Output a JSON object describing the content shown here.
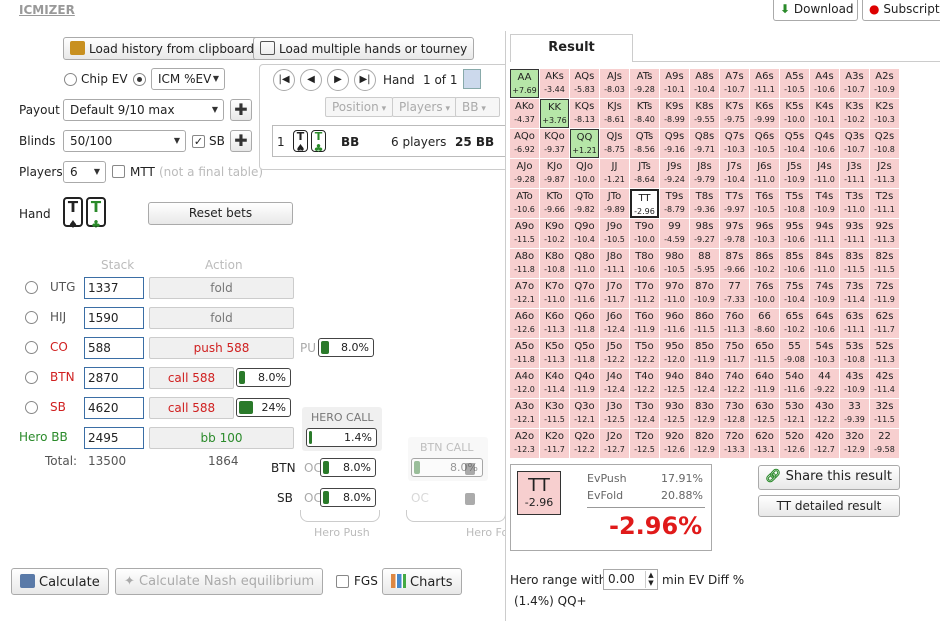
{
  "logo": "ICMIZER",
  "top": {
    "download": "Download",
    "subscription": "Subscriptio"
  },
  "load_clip": "Load history from clipboard",
  "load_multi": "Load multiple hands or tourney",
  "mode": {
    "chip_ev": "Chip EV",
    "icm": "ICM %EV"
  },
  "payout": {
    "label": "Payout",
    "value": "Default 9/10 max"
  },
  "blinds": {
    "label": "Blinds",
    "value": "50/100",
    "sb": "SB"
  },
  "players": {
    "label": "Players",
    "value": "6",
    "mtt": "MTT",
    "note": "(not a final table)"
  },
  "hand_label": "Hand",
  "reset": "Reset bets",
  "col_stack": "Stack",
  "col_action": "Action",
  "seats": [
    {
      "pos": "UTG",
      "stack": "1337",
      "action": "fold"
    },
    {
      "pos": "HIJ",
      "stack": "1590",
      "action": "fold"
    },
    {
      "pos": "CO",
      "stack": "588",
      "action": "push 588"
    },
    {
      "pos": "BTN",
      "stack": "2870",
      "action": "call 588"
    },
    {
      "pos": "SB",
      "stack": "4620",
      "action": "call 588"
    },
    {
      "pos": "Hero BB",
      "stack": "2495",
      "action": "bb 100"
    }
  ],
  "totals": {
    "label": "Total:",
    "stack": "13500",
    "action": "1864"
  },
  "pu": {
    "label": "PU",
    "value": "8.0%",
    "fill": 0.08
  },
  "btn_call_pct": {
    "value": "8.0%",
    "fill": 0.08
  },
  "sb_call_pct": {
    "value": "24%",
    "fill": 0.24
  },
  "hero_call": {
    "title": "HERO CALL",
    "value": "1.4%",
    "fill": 0.014
  },
  "btn_call": {
    "title": "BTN CALL",
    "value": "8.0%",
    "fill": 0.08
  },
  "side": {
    "btn": "BTN",
    "sb": "SB",
    "oc": "OC",
    "btn_value": "8.0%",
    "sb_value": "8.0%"
  },
  "hero_push": "Hero Push",
  "hero_fold": "Hero Fo",
  "hand_nav": {
    "label": "Hand",
    "count": "1 of 1"
  },
  "filters": [
    "Position",
    "Players",
    "BB"
  ],
  "hand_row": {
    "num": "1",
    "pos": "BB",
    "players": "6 players",
    "bb": "25 BB"
  },
  "result_tab": "Result",
  "grid": [
    [
      [
        "AA",
        "+7.69"
      ],
      [
        "AKs",
        "-3.44"
      ],
      [
        "AQs",
        "-5.83"
      ],
      [
        "AJs",
        "-8.03"
      ],
      [
        "ATs",
        "-9.28"
      ],
      [
        "A9s",
        "-10.1"
      ],
      [
        "A8s",
        "-10.4"
      ],
      [
        "A7s",
        "-10.7"
      ],
      [
        "A6s",
        "-11.1"
      ],
      [
        "A5s",
        "-10.5"
      ],
      [
        "A4s",
        "-10.6"
      ],
      [
        "A3s",
        "-10.7"
      ],
      [
        "A2s",
        "-10.9"
      ]
    ],
    [
      [
        "AKo",
        "-4.37"
      ],
      [
        "KK",
        "+3.76"
      ],
      [
        "KQs",
        "-8.13"
      ],
      [
        "KJs",
        "-8.61"
      ],
      [
        "KTs",
        "-8.40"
      ],
      [
        "K9s",
        "-8.99"
      ],
      [
        "K8s",
        "-9.55"
      ],
      [
        "K7s",
        "-9.75"
      ],
      [
        "K6s",
        "-9.99"
      ],
      [
        "K5s",
        "-10.0"
      ],
      [
        "K4s",
        "-10.1"
      ],
      [
        "K3s",
        "-10.2"
      ],
      [
        "K2s",
        "-10.3"
      ]
    ],
    [
      [
        "AQo",
        "-6.92"
      ],
      [
        "KQo",
        "-9.37"
      ],
      [
        "QQ",
        "+1.21"
      ],
      [
        "QJs",
        "-8.75"
      ],
      [
        "QTs",
        "-8.56"
      ],
      [
        "Q9s",
        "-9.16"
      ],
      [
        "Q8s",
        "-9.71"
      ],
      [
        "Q7s",
        "-10.3"
      ],
      [
        "Q6s",
        "-10.5"
      ],
      [
        "Q5s",
        "-10.4"
      ],
      [
        "Q4s",
        "-10.6"
      ],
      [
        "Q3s",
        "-10.7"
      ],
      [
        "Q2s",
        "-10.8"
      ]
    ],
    [
      [
        "AJo",
        "-9.28"
      ],
      [
        "KJo",
        "-9.87"
      ],
      [
        "QJo",
        "-10.0"
      ],
      [
        "JJ",
        "-1.21"
      ],
      [
        "JTs",
        "-8.64"
      ],
      [
        "J9s",
        "-9.24"
      ],
      [
        "J8s",
        "-9.79"
      ],
      [
        "J7s",
        "-10.4"
      ],
      [
        "J6s",
        "-11.0"
      ],
      [
        "J5s",
        "-10.9"
      ],
      [
        "J4s",
        "-11.0"
      ],
      [
        "J3s",
        "-11.1"
      ],
      [
        "J2s",
        "-11.3"
      ]
    ],
    [
      [
        "ATo",
        "-10.6"
      ],
      [
        "KTo",
        "-9.66"
      ],
      [
        "QTo",
        "-9.82"
      ],
      [
        "JTo",
        "-9.89"
      ],
      [
        "TT",
        "-2.96"
      ],
      [
        "T9s",
        "-8.79"
      ],
      [
        "T8s",
        "-9.36"
      ],
      [
        "T7s",
        "-9.97"
      ],
      [
        "T6s",
        "-10.5"
      ],
      [
        "T5s",
        "-10.8"
      ],
      [
        "T4s",
        "-10.9"
      ],
      [
        "T3s",
        "-11.0"
      ],
      [
        "T2s",
        "-11.1"
      ]
    ],
    [
      [
        "A9o",
        "-11.5"
      ],
      [
        "K9o",
        "-10.2"
      ],
      [
        "Q9o",
        "-10.4"
      ],
      [
        "J9o",
        "-10.5"
      ],
      [
        "T9o",
        "-10.0"
      ],
      [
        "99",
        "-4.59"
      ],
      [
        "98s",
        "-9.27"
      ],
      [
        "97s",
        "-9.78"
      ],
      [
        "96s",
        "-10.3"
      ],
      [
        "95s",
        "-10.6"
      ],
      [
        "94s",
        "-11.1"
      ],
      [
        "93s",
        "-11.1"
      ],
      [
        "92s",
        "-11.3"
      ]
    ],
    [
      [
        "A8o",
        "-11.8"
      ],
      [
        "K8o",
        "-10.8"
      ],
      [
        "Q8o",
        "-11.0"
      ],
      [
        "J8o",
        "-11.1"
      ],
      [
        "T8o",
        "-10.6"
      ],
      [
        "98o",
        "-10.5"
      ],
      [
        "88",
        "-5.95"
      ],
      [
        "87s",
        "-9.66"
      ],
      [
        "86s",
        "-10.2"
      ],
      [
        "85s",
        "-10.6"
      ],
      [
        "84s",
        "-11.0"
      ],
      [
        "83s",
        "-11.5"
      ],
      [
        "82s",
        "-11.5"
      ]
    ],
    [
      [
        "A7o",
        "-12.1"
      ],
      [
        "K7o",
        "-11.0"
      ],
      [
        "Q7o",
        "-11.6"
      ],
      [
        "J7o",
        "-11.7"
      ],
      [
        "T7o",
        "-11.2"
      ],
      [
        "97o",
        "-11.0"
      ],
      [
        "87o",
        "-10.9"
      ],
      [
        "77",
        "-7.33"
      ],
      [
        "76s",
        "-10.0"
      ],
      [
        "75s",
        "-10.4"
      ],
      [
        "74s",
        "-10.9"
      ],
      [
        "73s",
        "-11.4"
      ],
      [
        "72s",
        "-11.9"
      ]
    ],
    [
      [
        "A6o",
        "-12.6"
      ],
      [
        "K6o",
        "-11.3"
      ],
      [
        "Q6o",
        "-11.8"
      ],
      [
        "J6o",
        "-12.4"
      ],
      [
        "T6o",
        "-11.9"
      ],
      [
        "96o",
        "-11.6"
      ],
      [
        "86o",
        "-11.5"
      ],
      [
        "76o",
        "-11.3"
      ],
      [
        "66",
        "-8.60"
      ],
      [
        "65s",
        "-10.2"
      ],
      [
        "64s",
        "-10.6"
      ],
      [
        "63s",
        "-11.1"
      ],
      [
        "62s",
        "-11.7"
      ]
    ],
    [
      [
        "A5o",
        "-11.8"
      ],
      [
        "K5o",
        "-11.3"
      ],
      [
        "Q5o",
        "-11.8"
      ],
      [
        "J5o",
        "-12.2"
      ],
      [
        "T5o",
        "-12.2"
      ],
      [
        "95o",
        "-12.0"
      ],
      [
        "85o",
        "-11.9"
      ],
      [
        "75o",
        "-11.7"
      ],
      [
        "65o",
        "-11.5"
      ],
      [
        "55",
        "-9.08"
      ],
      [
        "54s",
        "-10.3"
      ],
      [
        "53s",
        "-10.8"
      ],
      [
        "52s",
        "-11.3"
      ]
    ],
    [
      [
        "A4o",
        "-12.0"
      ],
      [
        "K4o",
        "-11.4"
      ],
      [
        "Q4o",
        "-11.9"
      ],
      [
        "J4o",
        "-12.4"
      ],
      [
        "T4o",
        "-12.2"
      ],
      [
        "94o",
        "-12.5"
      ],
      [
        "84o",
        "-12.4"
      ],
      [
        "74o",
        "-12.2"
      ],
      [
        "64o",
        "-11.9"
      ],
      [
        "54o",
        "-11.6"
      ],
      [
        "44",
        "-9.22"
      ],
      [
        "43s",
        "-10.9"
      ],
      [
        "42s",
        "-11.4"
      ]
    ],
    [
      [
        "A3o",
        "-12.1"
      ],
      [
        "K3o",
        "-11.5"
      ],
      [
        "Q3o",
        "-12.1"
      ],
      [
        "J3o",
        "-12.5"
      ],
      [
        "T3o",
        "-12.4"
      ],
      [
        "93o",
        "-12.5"
      ],
      [
        "83o",
        "-12.9"
      ],
      [
        "73o",
        "-12.8"
      ],
      [
        "63o",
        "-12.5"
      ],
      [
        "53o",
        "-12.1"
      ],
      [
        "43o",
        "-12.2"
      ],
      [
        "33",
        "-9.39"
      ],
      [
        "32s",
        "-11.5"
      ]
    ],
    [
      [
        "A2o",
        "-12.3"
      ],
      [
        "K2o",
        "-11.7"
      ],
      [
        "Q2o",
        "-12.2"
      ],
      [
        "J2o",
        "-12.7"
      ],
      [
        "T2o",
        "-12.5"
      ],
      [
        "92o",
        "-12.6"
      ],
      [
        "82o",
        "-12.9"
      ],
      [
        "72o",
        "-13.3"
      ],
      [
        "62o",
        "-13.1"
      ],
      [
        "52o",
        "-12.6"
      ],
      [
        "42o",
        "-12.7"
      ],
      [
        "32o",
        "-12.9"
      ],
      [
        "22",
        "-9.58"
      ]
    ]
  ],
  "detail": {
    "hand": "TT",
    "value": "-2.96",
    "evpush_label": "EvPush",
    "evpush": "17.91%",
    "evfold_label": "EvFold",
    "evfold": "20.88%",
    "diff": "-2.96%"
  },
  "share": "Share this result",
  "tt_detail": "TT detailed result",
  "hero_range": {
    "label": "Hero range with",
    "value": "0.00",
    "suffix": "min EV Diff %",
    "result": "(1.4%) QQ+"
  },
  "bottom": {
    "calculate": "Calculate",
    "nash": "Calculate Nash equilibrium",
    "fgs": "FGS",
    "charts": "Charts"
  }
}
